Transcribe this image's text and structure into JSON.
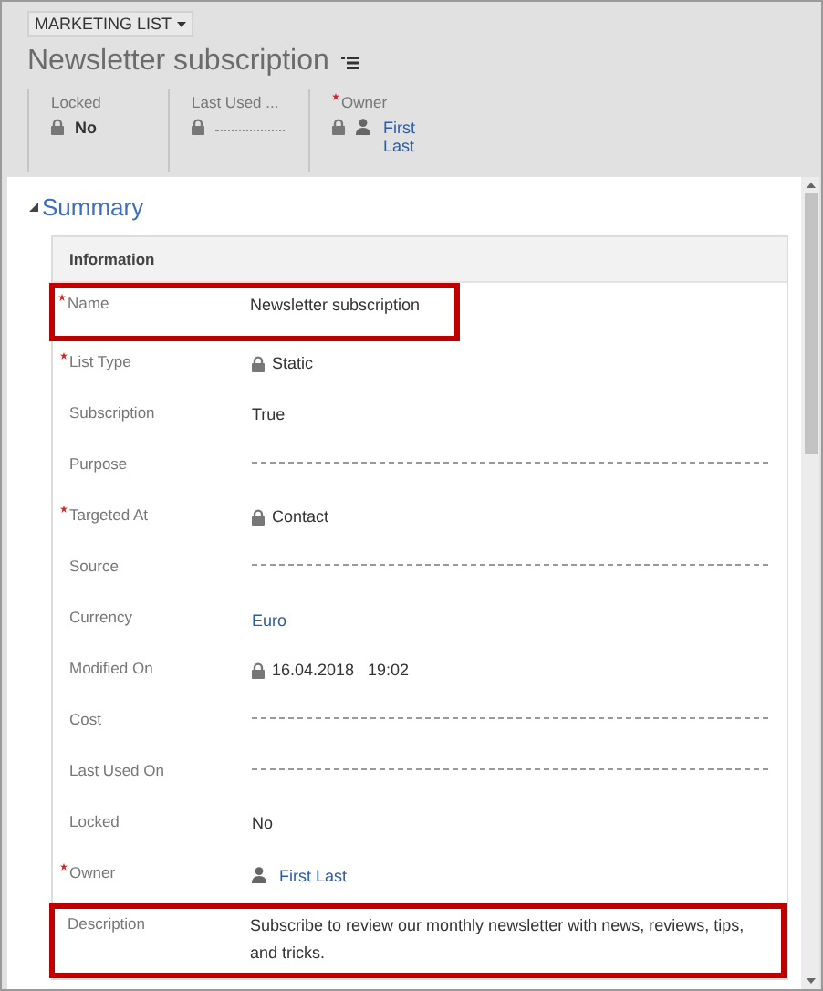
{
  "entity_button": {
    "label": "MARKETING LIST"
  },
  "title": "Newsletter subscription",
  "header_fields": [
    {
      "label": "Locked",
      "value": "No",
      "kind": "text",
      "locked": true,
      "required": false
    },
    {
      "label": "Last Used ...",
      "kind": "empty",
      "locked": true,
      "required": false
    },
    {
      "label": "Owner",
      "value": "First Last",
      "kind": "person",
      "locked": true,
      "required": true
    }
  ],
  "section": {
    "title": "Summary",
    "expanded": true
  },
  "card": {
    "title": "Information",
    "fields": [
      {
        "label": "Name",
        "value": "Newsletter subscription",
        "kind": "text",
        "required": true,
        "locked": false,
        "highlighted": true
      },
      {
        "label": "List Type",
        "value": "Static",
        "kind": "text",
        "required": true,
        "locked": true,
        "highlighted": false
      },
      {
        "label": "Subscription",
        "value": "True",
        "kind": "text",
        "required": false,
        "locked": false,
        "highlighted": false
      },
      {
        "label": "Purpose",
        "kind": "empty",
        "required": false,
        "locked": false,
        "highlighted": false
      },
      {
        "label": "Targeted At",
        "value": "Contact",
        "kind": "text",
        "required": true,
        "locked": true,
        "highlighted": false
      },
      {
        "label": "Source",
        "kind": "empty",
        "required": false,
        "locked": false,
        "highlighted": false
      },
      {
        "label": "Currency",
        "value": "Euro",
        "kind": "link",
        "required": false,
        "locked": false,
        "highlighted": false
      },
      {
        "label": "Modified On",
        "value": "16.04.2018   19:02",
        "kind": "text",
        "required": false,
        "locked": true,
        "highlighted": false
      },
      {
        "label": "Cost",
        "kind": "empty",
        "required": false,
        "locked": false,
        "highlighted": false
      },
      {
        "label": "Last Used On",
        "kind": "empty",
        "required": false,
        "locked": false,
        "highlighted": false
      },
      {
        "label": "Locked",
        "value": "No",
        "kind": "text",
        "required": false,
        "locked": false,
        "highlighted": false
      },
      {
        "label": "Owner",
        "value": "First Last",
        "kind": "person",
        "required": true,
        "locked": false,
        "highlighted": false
      },
      {
        "label": "Description",
        "value": "Subscribe to review our monthly newsletter with news, reviews, tips, and tricks.",
        "kind": "text",
        "required": false,
        "locked": false,
        "highlighted": true
      }
    ]
  }
}
